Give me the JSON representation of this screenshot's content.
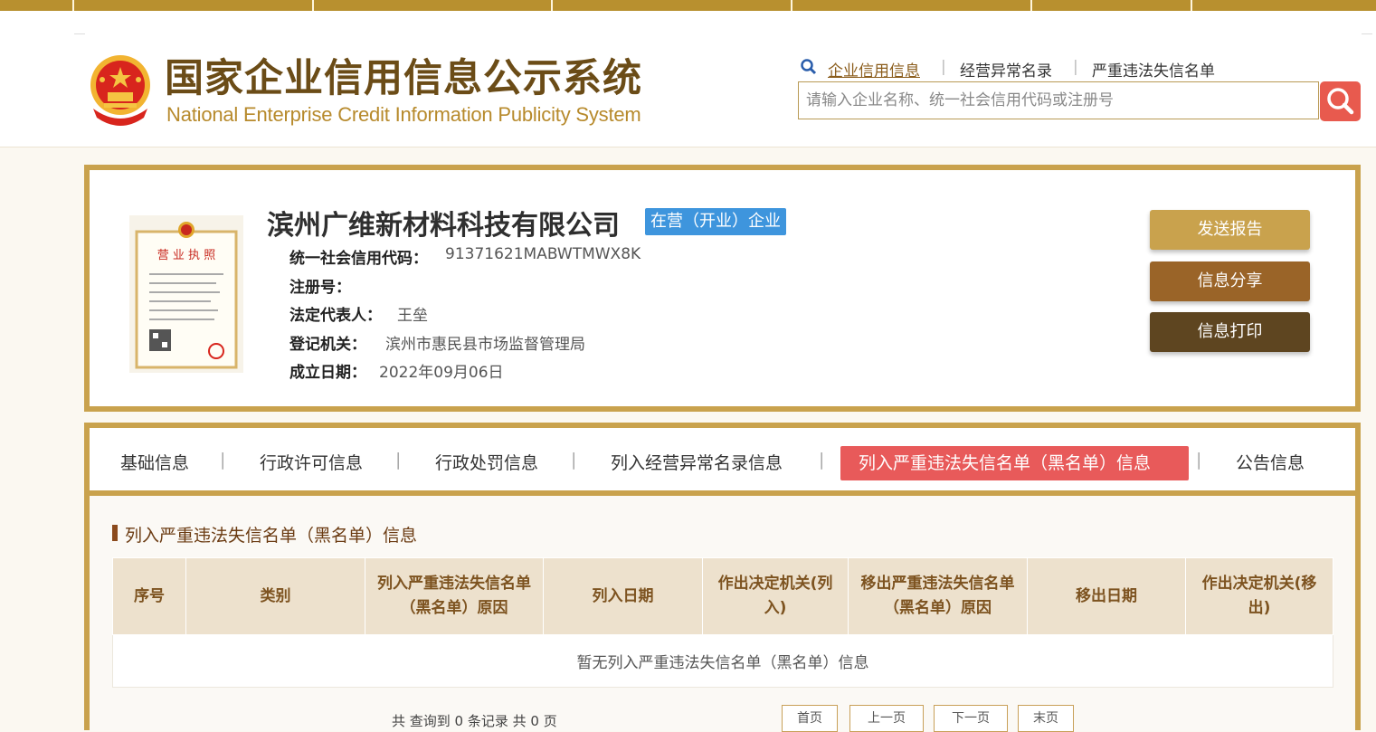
{
  "header": {
    "title_cn": "国家企业信用信息公示系统",
    "title_en": "National Enterprise Credit Information Publicity System",
    "links": [
      "企业信用信息",
      "经营异常名录",
      "严重违法失信名单"
    ],
    "search_placeholder": "请输入企业名称、统一社会信用代码或注册号"
  },
  "company": {
    "name": "滨州广维新材料科技有限公司",
    "status": "在营（开业）企业",
    "fields": [
      {
        "label": "统一社会信用代码：",
        "value": "91371621MABWTMWX8K"
      },
      {
        "label": "注册号：",
        "value": ""
      },
      {
        "label": "法定代表人：",
        "value": "王垒"
      },
      {
        "label": "登记机关：",
        "value": "滨州市惠民县市场监督管理局"
      },
      {
        "label": "成立日期：",
        "value": "2022年09月06日"
      }
    ],
    "license_text": "营 业 执 照"
  },
  "actions": [
    "发送报告",
    "信息分享",
    "信息打印"
  ],
  "tabs": [
    "基础信息",
    "行政许可信息",
    "行政处罚信息",
    "列入经营异常名录信息",
    "列入严重违法失信名单（黑名单）信息",
    "公告信息"
  ],
  "active_tab": 4,
  "section": {
    "title": "列入严重违法失信名单（黑名单）信息",
    "columns": [
      "序号",
      "类别",
      "列入严重违法失信名单（黑名单）原因",
      "列入日期",
      "作出决定机关(列入)",
      "移出严重违法失信名单（黑名单）原因",
      "移出日期",
      "作出决定机关(移出)"
    ],
    "empty_text": "暂无列入严重违法失信名单（黑名单）信息"
  },
  "pagination": {
    "summary": "共 查询到 0 条记录 共 0 页",
    "buttons": [
      "首页",
      "上一页",
      "下一页",
      "末页"
    ]
  },
  "colors": {
    "gold": "#c9a24d",
    "brown_title": "#6b4c17",
    "active_tab": "#e85a5a",
    "status_blue": "#3e95dd",
    "btn_report": "#c9a24d",
    "btn_share": "#9a6428",
    "btn_print": "#5e4520"
  }
}
